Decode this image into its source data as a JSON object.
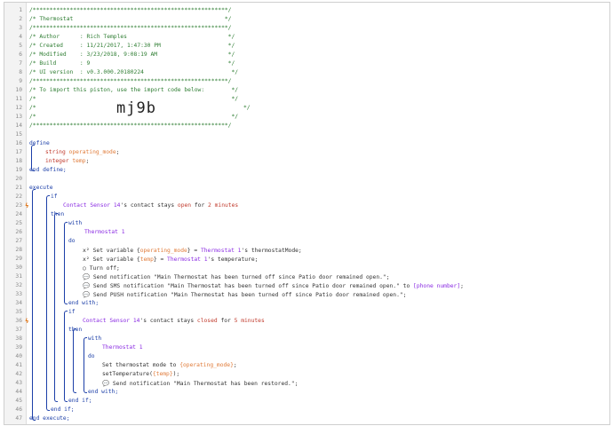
{
  "gutter": {
    "line_numbers": [
      "1",
      "2",
      "3",
      "4",
      "5",
      "6",
      "7",
      "8",
      "9",
      "10",
      "11",
      "12",
      "13",
      "14",
      "15",
      "16",
      "17",
      "18",
      "19",
      "20",
      "21",
      "22",
      "23",
      "24",
      "25",
      "26",
      "27",
      "28",
      "29",
      "30",
      "31",
      "32",
      "33",
      "34",
      "35",
      "36",
      "37",
      "38",
      "39",
      "40",
      "41",
      "42",
      "43",
      "44",
      "45",
      "46",
      "47"
    ],
    "trigger_icon": "bolt-icon"
  },
  "header": {
    "border": "/**********************************************************/",
    "title_line": "/* Thermostat                                             */",
    "author_line": "/* Author      : Rich Temples                              */",
    "created_line": "/* Created     : 11/21/2017, 1:47:30 PM                    */",
    "modified_line": "/* Modified    : 3/23/2018, 9:08:19 AM                     */",
    "build_line": "/* Build       : 9                                         */",
    "ui_line": "/* UI version  : v0.3.000.20180224                          */",
    "import_line": "/* To import this piston, use the import code below:        */",
    "empty_line": "/*                                                          */",
    "code_prefix": "/*",
    "code_suffix": "*/",
    "import_code": "mj9b"
  },
  "define": {
    "open": "define",
    "v1_type": "string",
    "v1_name": "operating_mode",
    "v2_type": "integer",
    "v2_name": "temp",
    "close": "end define;"
  },
  "execute": {
    "open": "execute",
    "if1": "if",
    "cond1_device": "Contact Sensor 14",
    "cond1_attr": "'s contact stays ",
    "cond1_state": "open",
    "cond1_for": " for ",
    "cond1_dur": "2 minutes",
    "then1": "then",
    "with1": "with",
    "with1_device": "Thermostat 1",
    "do1": "do",
    "a1_pre": "Set variable {",
    "a1_var": "operating_mode",
    "a1_mid": "} = ",
    "a1_dev": "Thermostat 1",
    "a1_post": "'s thermostatMode;",
    "a2_pre": "Set variable {",
    "a2_var": "temp",
    "a2_mid": "} = ",
    "a2_dev": "Thermostat 1",
    "a2_post": "'s temperature;",
    "a3": "Turn off;",
    "a4": "Send notification \"Main Thermostat has been turned off since Patio door remained open.\";",
    "a5_pre": "Send SMS notification \"Main Thermostat has been turned off since Patio door remained open.\" to ",
    "a5_phone": "[phone number]",
    "a5_post": ";",
    "a6": "Send PUSH notification \"Main Thermostat has been turned off since Patio door remained open.\";",
    "endwith1": "end with;",
    "if2": "if",
    "cond2_device": "Contact Sensor 14",
    "cond2_attr": "'s contact stays ",
    "cond2_state": "closed",
    "cond2_for": " for ",
    "cond2_dur": "5 minutes",
    "then2": "then",
    "with2": "with",
    "with2_device": "Thermostat 1",
    "do2": "do",
    "b1_pre": "Set thermostat mode to ",
    "b1_var": "{operating_mode}",
    "b1_post": ";",
    "b2_pre": "setTemperature(",
    "b2_var": "{temp}",
    "b2_post": ");",
    "b3": "Send notification \"Main Thermostat has been restored.\";",
    "endwith2": "end with;",
    "endif2": "end if;",
    "endif1": "end if;",
    "close": "end execute;"
  },
  "icons": {
    "set_variable": "x²",
    "turn_off": "○",
    "notify": "💬"
  }
}
